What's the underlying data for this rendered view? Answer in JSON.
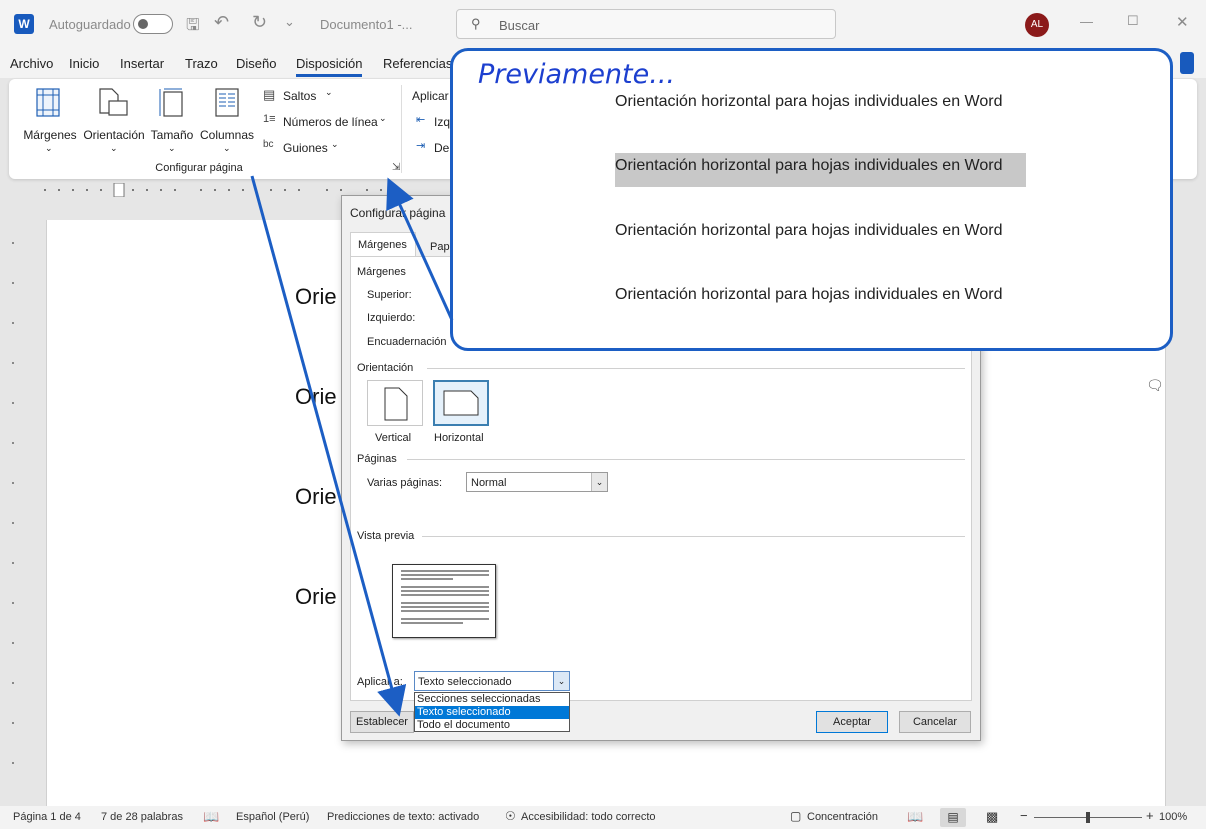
{
  "titlebar": {
    "autosave": "Autoguardado",
    "doc_title": "Documento1 -...",
    "search_placeholder": "Buscar",
    "avatar_initials": "AL"
  },
  "tabs": [
    "Archivo",
    "Inicio",
    "Insertar",
    "Trazo",
    "Diseño",
    "Disposición",
    "Referencias"
  ],
  "ribbon": {
    "margenes": "Márgenes",
    "orientacion": "Orientación",
    "tamano": "Tamaño",
    "columnas": "Columnas",
    "saltos": "Saltos",
    "numeros_linea": "Números de línea",
    "guiones": "Guiones",
    "group_label": "Configurar página",
    "aplicar": "Aplicar",
    "izq": "Izq",
    "de": "De"
  },
  "document": {
    "lines": [
      "Orie",
      "Orie",
      "Orie",
      "Orie"
    ]
  },
  "dialog": {
    "title": "Configurar página",
    "tab_margenes": "Márgenes",
    "tab_papel": "Pap",
    "section_margenes": "Márgenes",
    "superior": "Superior:",
    "izquierdo": "Izquierdo:",
    "encuadernacion": "Encuadernación",
    "section_orientacion": "Orientación",
    "vertical": "Vertical",
    "horizontal": "Horizontal",
    "section_paginas": "Páginas",
    "varias_paginas": "Varias páginas:",
    "varias_value": "Normal",
    "section_vista": "Vista previa",
    "aplicar_a": "Aplicar a:",
    "aplicar_value": "Texto seleccionado",
    "aplicar_options": [
      "Secciones seleccionadas",
      "Texto seleccionado",
      "Todo el documento"
    ],
    "establecer": "Establecer",
    "aceptar": "Aceptar",
    "cancelar": "Cancelar"
  },
  "callout": {
    "title": "Previamente...",
    "lines": [
      "Orientación horizontal para hojas individuales en Word",
      "Orientación horizontal para hojas individuales en Word",
      "Orientación horizontal para hojas individuales en Word",
      "Orientación horizontal para hojas individuales en Word"
    ]
  },
  "statusbar": {
    "pagina": "Página 1 de 4",
    "palabras": "7 de 28 palabras",
    "idioma": "Español (Perú)",
    "predicciones": "Predicciones de texto: activado",
    "accesibilidad": "Accesibilidad: todo correcto",
    "concentracion": "Concentración",
    "zoom": "100%"
  },
  "colors": {
    "accent": "#185abd",
    "callout_border": "#1c5ec4",
    "selection": "#0078d7"
  }
}
